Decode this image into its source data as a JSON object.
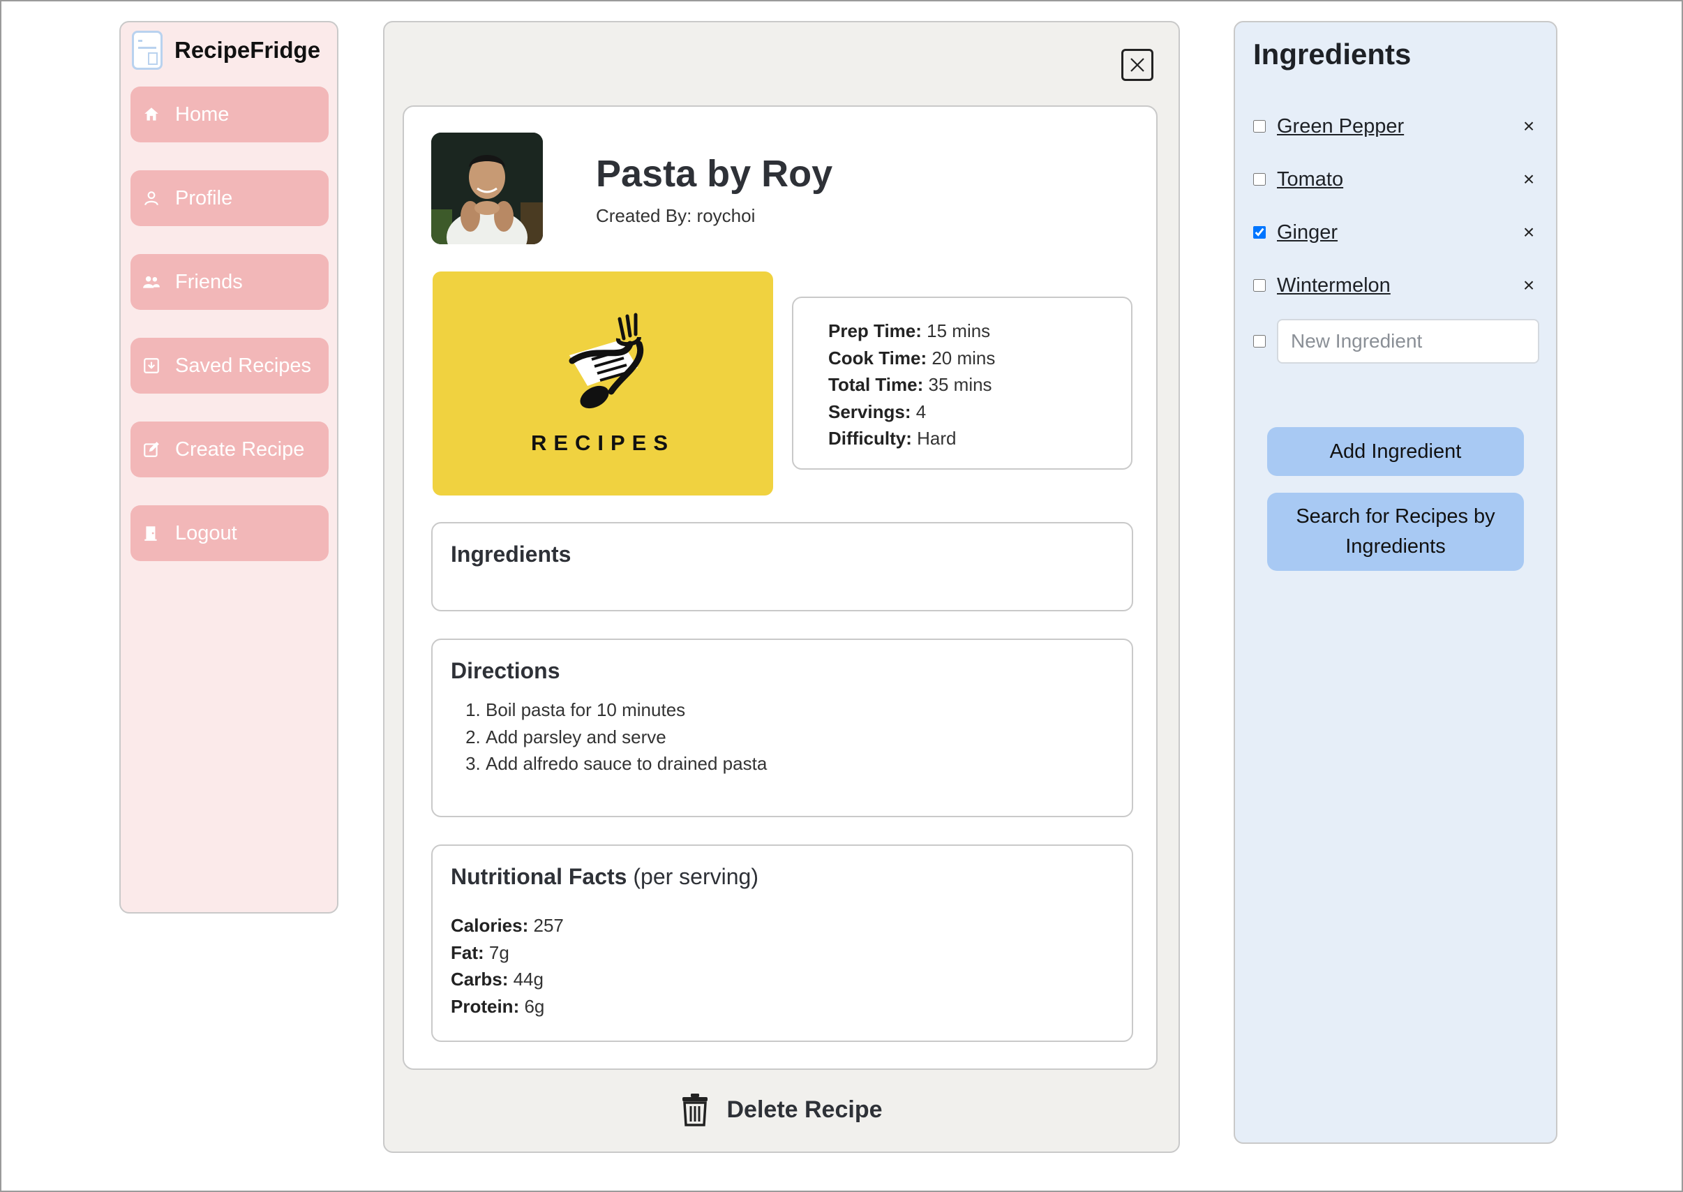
{
  "app": {
    "name": "RecipeFridge"
  },
  "sidebar": {
    "items": [
      {
        "label": "Home",
        "icon": "home-icon"
      },
      {
        "label": "Profile",
        "icon": "user-icon"
      },
      {
        "label": "Friends",
        "icon": "users-icon"
      },
      {
        "label": "Saved Recipes",
        "icon": "download-icon"
      },
      {
        "label": "Create Recipe",
        "icon": "edit-icon"
      },
      {
        "label": "Logout",
        "icon": "door-icon"
      }
    ]
  },
  "recipe": {
    "title": "Pasta by Roy",
    "created_by_label": "Created By:",
    "created_by": "roychoi",
    "image_text": "RECIPES",
    "times": {
      "prep_label": "Prep Time:",
      "prep": "15 mins",
      "cook_label": "Cook Time:",
      "cook": "20 mins",
      "total_label": "Total Time:",
      "total": "35 mins",
      "servings_label": "Servings:",
      "servings": "4",
      "difficulty_label": "Difficulty:",
      "difficulty": "Hard"
    },
    "ingredients_heading": "Ingredients",
    "directions_heading": "Directions",
    "directions": [
      "Boil pasta for 10 minutes",
      "Add parsley and serve",
      "Add alfredo sauce to drained pasta"
    ],
    "nutrition": {
      "heading": "Nutritional Facts",
      "subheading": "(per serving)",
      "calories_label": "Calories:",
      "calories": "257",
      "fat_label": "Fat:",
      "fat": "7g",
      "carbs_label": "Carbs:",
      "carbs": "44g",
      "protein_label": "Protein:",
      "protein": "6g"
    },
    "delete_label": "Delete Recipe"
  },
  "fridge": {
    "title": "Ingredients",
    "items": [
      {
        "name": "Green Pepper",
        "checked": false
      },
      {
        "name": "Tomato",
        "checked": false
      },
      {
        "name": "Ginger",
        "checked": true
      },
      {
        "name": "Wintermelon",
        "checked": false
      }
    ],
    "remove_symbol": "×",
    "new_placeholder": "New Ingredient",
    "add_button": "Add Ingredient",
    "search_button": "Search for Recipes by Ingredients"
  },
  "colors": {
    "sidebar_bg": "#fbeaea",
    "nav_button": "#f2b7b8",
    "main_bg": "#f1f0ed",
    "recipe_image_bg": "#f0d240",
    "right_panel_bg": "#e6eef8",
    "blue_button": "#a8c9f3"
  }
}
